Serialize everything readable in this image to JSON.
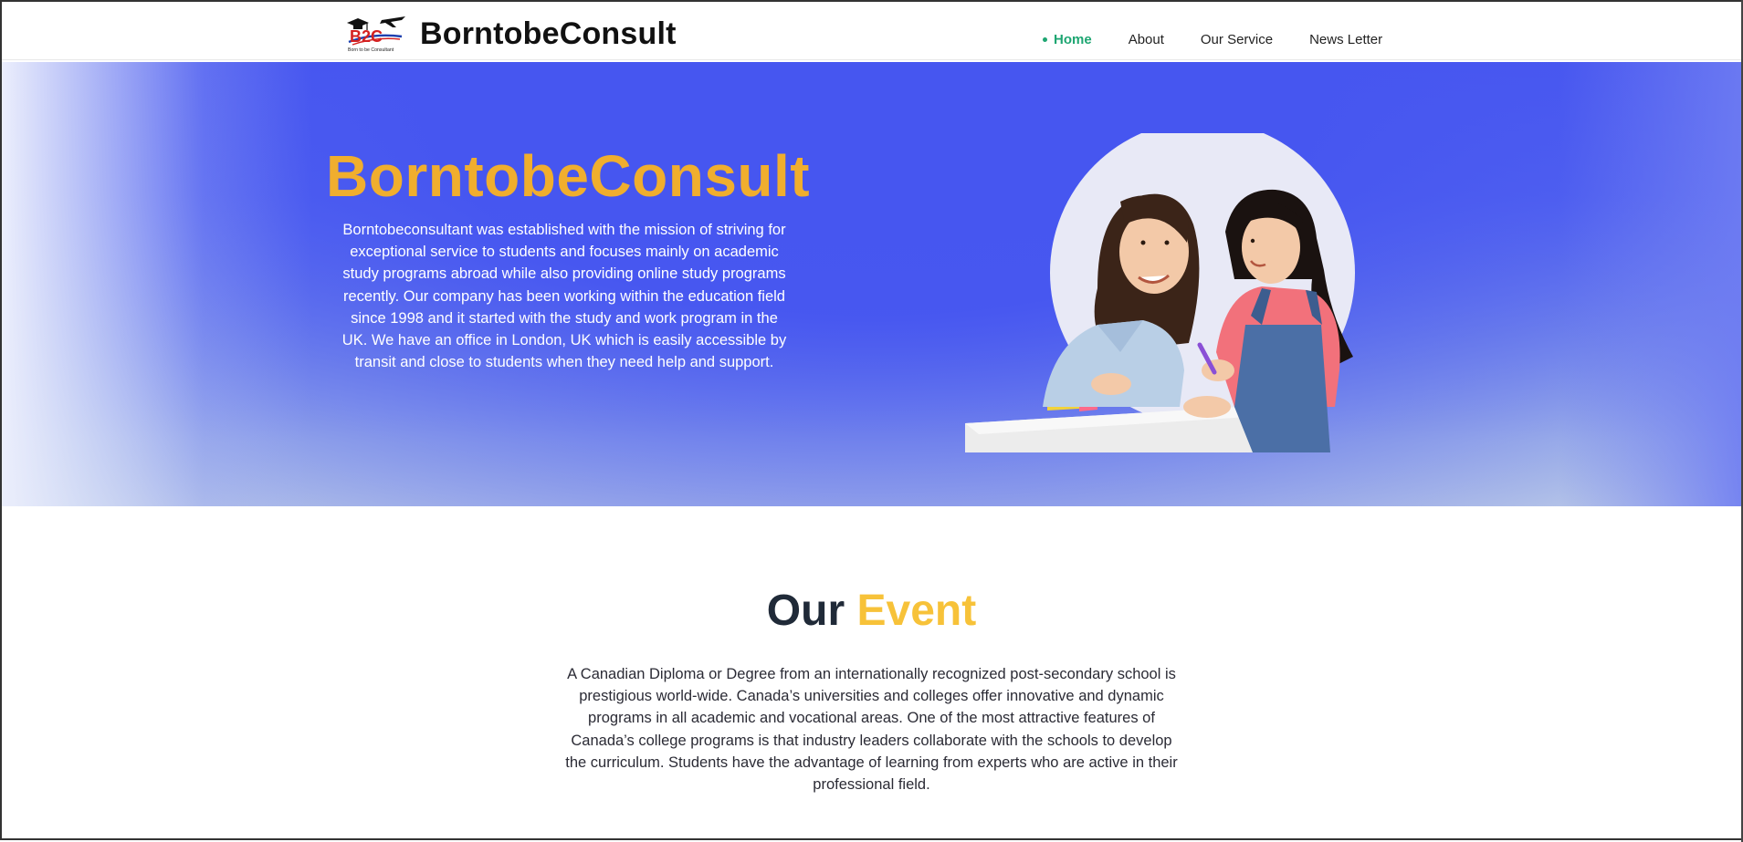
{
  "header": {
    "brand": "BorntobeConsult",
    "logo_text": "B2C",
    "logo_tagline": "Born to be Consultant",
    "nav": [
      {
        "label": "Home",
        "active": true
      },
      {
        "label": "About",
        "active": false
      },
      {
        "label": "Our Service",
        "active": false
      },
      {
        "label": "News Letter",
        "active": false
      }
    ]
  },
  "hero": {
    "title": "BorntobeConsult",
    "description": "Borntobeconsultant  was established with the mission of striving for exceptional service to students and focuses mainly on academic study programs abroad while also providing online study programs recently. Our company has been working within the education field since 1998 and it started with the study and work program in the UK. We have an office in London, UK which is easily accessible by transit and close to students when they need help and support."
  },
  "event": {
    "title_part1": "Our",
    "title_part2": "Event",
    "description": "A Canadian Diploma or Degree from an internationally recognized post-secondary school is prestigious world-wide. Canada’s universities and colleges offer innovative and dynamic programs in all academic and vocational areas. One of the most attractive features of Canada’s college programs is that industry leaders collaborate with the schools to develop the curriculum. Students have the advantage of learning from experts who are active in their professional field."
  },
  "colors": {
    "accent_gold": "#f0ae2e",
    "event_accent": "#f7c239",
    "nav_active": "#1ea672",
    "hero_blue": "#4a58f0"
  },
  "icons": {
    "logo": "graduation-cap-airplane-logo",
    "nav_active_marker": "dot"
  }
}
